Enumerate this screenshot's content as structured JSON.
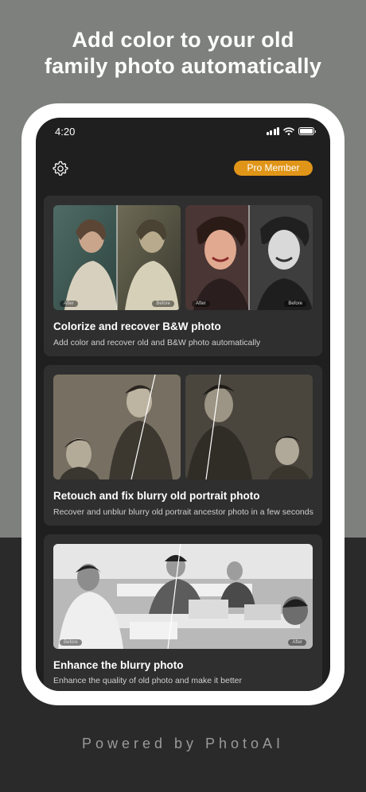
{
  "headline": {
    "line1": "Add color to your old",
    "line2": "family photo automatically"
  },
  "status_bar": {
    "time": "4:20"
  },
  "header": {
    "settings_icon": "gear-icon",
    "pro_label": "Pro Member",
    "accent_color": "#e09518"
  },
  "cards": [
    {
      "title": "Colorize and recover B&W photo",
      "description": "Add color and recover old and B&W photo automatically",
      "tags": [
        "After",
        "Before",
        "After",
        "Before"
      ]
    },
    {
      "title": "Retouch and fix blurry old portrait photo",
      "description": "Recover and unblur blurry old portrait ancestor photo in a few seconds"
    },
    {
      "title": "Enhance the blurry photo",
      "description": "Enhance the quality of old photo and make it better",
      "tags": [
        "Before",
        "After"
      ]
    }
  ],
  "footer": {
    "text": "Powered by PhotoAI"
  }
}
